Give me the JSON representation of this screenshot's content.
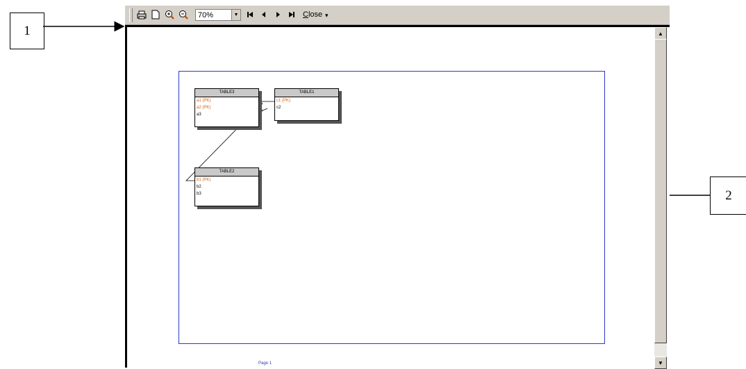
{
  "callouts": {
    "one": "1",
    "two": "2"
  },
  "toolbar": {
    "zoom_value": "70%",
    "close_label": "lose",
    "close_underlined": "C",
    "icons": [
      "printer-icon",
      "page-setup-icon",
      "zoom-in-icon",
      "zoom-out-icon",
      "first-page-icon",
      "previous-page-icon",
      "next-page-icon",
      "last-page-icon"
    ]
  },
  "tables": {
    "t3": {
      "title": "TABLE3",
      "rows": [
        "a1 (PK)",
        "a2 (PK)",
        "a3"
      ]
    },
    "t1": {
      "title": "TABLE1",
      "rows": [
        "c1 (PK)",
        "c2"
      ]
    },
    "t2": {
      "title": "TABLE2",
      "rows": [
        "b1 (PK)",
        "b2",
        "b3"
      ]
    }
  },
  "page": {
    "number_label": "Page 1"
  },
  "colors": {
    "pk": "#d2600a",
    "frame": "#2a3ac0",
    "chrome": "#d4d0c8"
  }
}
